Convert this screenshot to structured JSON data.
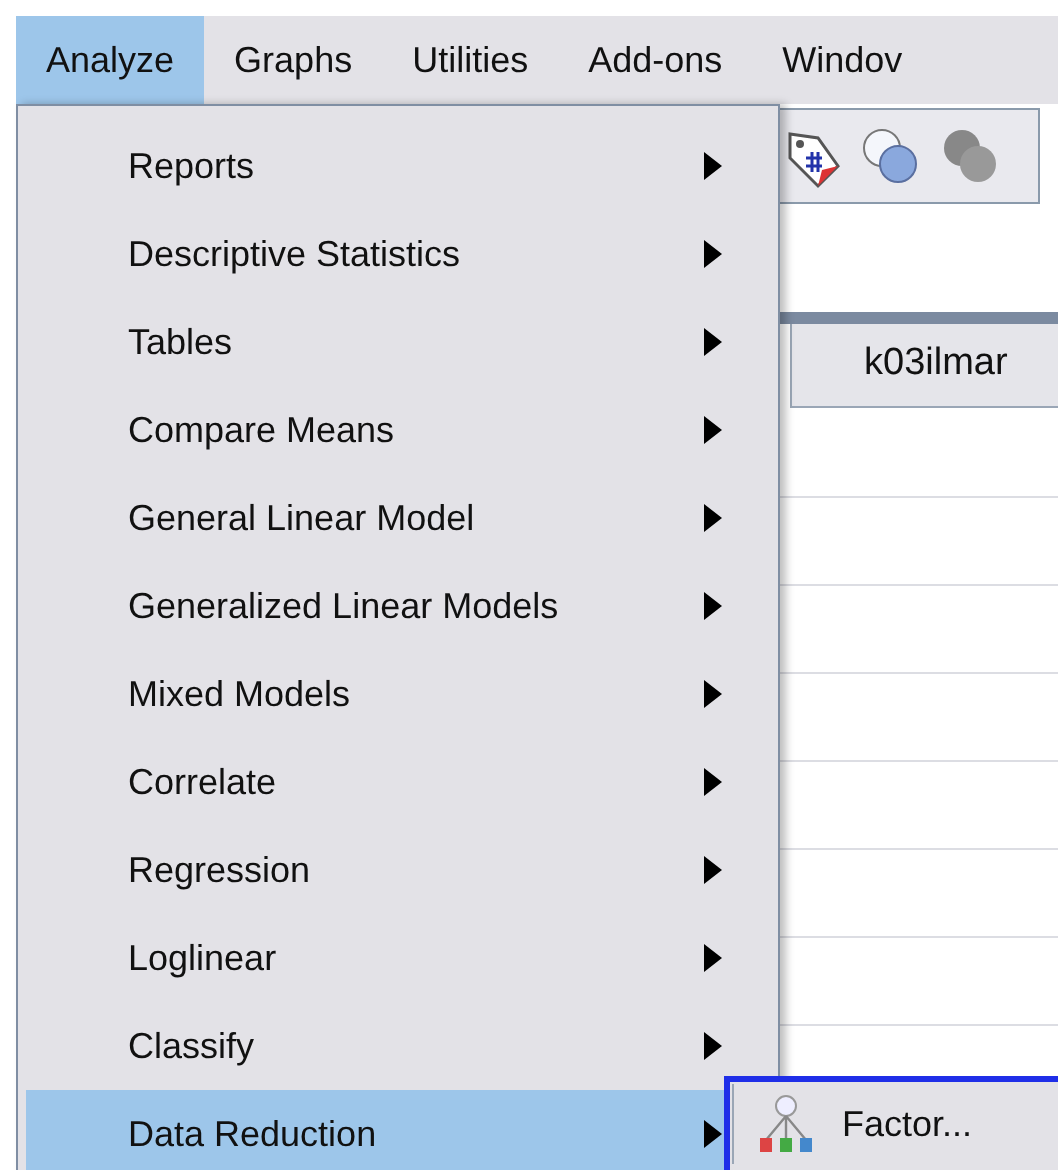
{
  "menu_bar": [
    {
      "label": "Analyze",
      "selected": true
    },
    {
      "label": "Graphs",
      "selected": false
    },
    {
      "label": "Utilities",
      "selected": false
    },
    {
      "label": "Add-ons",
      "selected": false
    },
    {
      "label": "Windov",
      "selected": false
    }
  ],
  "grid": {
    "column_header": "k03ilmar"
  },
  "analyze_menu": [
    {
      "label": "Reports",
      "selected": false
    },
    {
      "label": "Descriptive Statistics",
      "selected": false
    },
    {
      "label": "Tables",
      "selected": false
    },
    {
      "label": "Compare Means",
      "selected": false
    },
    {
      "label": "General Linear Model",
      "selected": false
    },
    {
      "label": "Generalized Linear Models",
      "selected": false
    },
    {
      "label": "Mixed Models",
      "selected": false
    },
    {
      "label": "Correlate",
      "selected": false
    },
    {
      "label": "Regression",
      "selected": false
    },
    {
      "label": "Loglinear",
      "selected": false
    },
    {
      "label": "Classify",
      "selected": false
    },
    {
      "label": "Data Reduction",
      "selected": true
    }
  ],
  "submenu": [
    {
      "label": "Factor...",
      "selected": true
    }
  ]
}
